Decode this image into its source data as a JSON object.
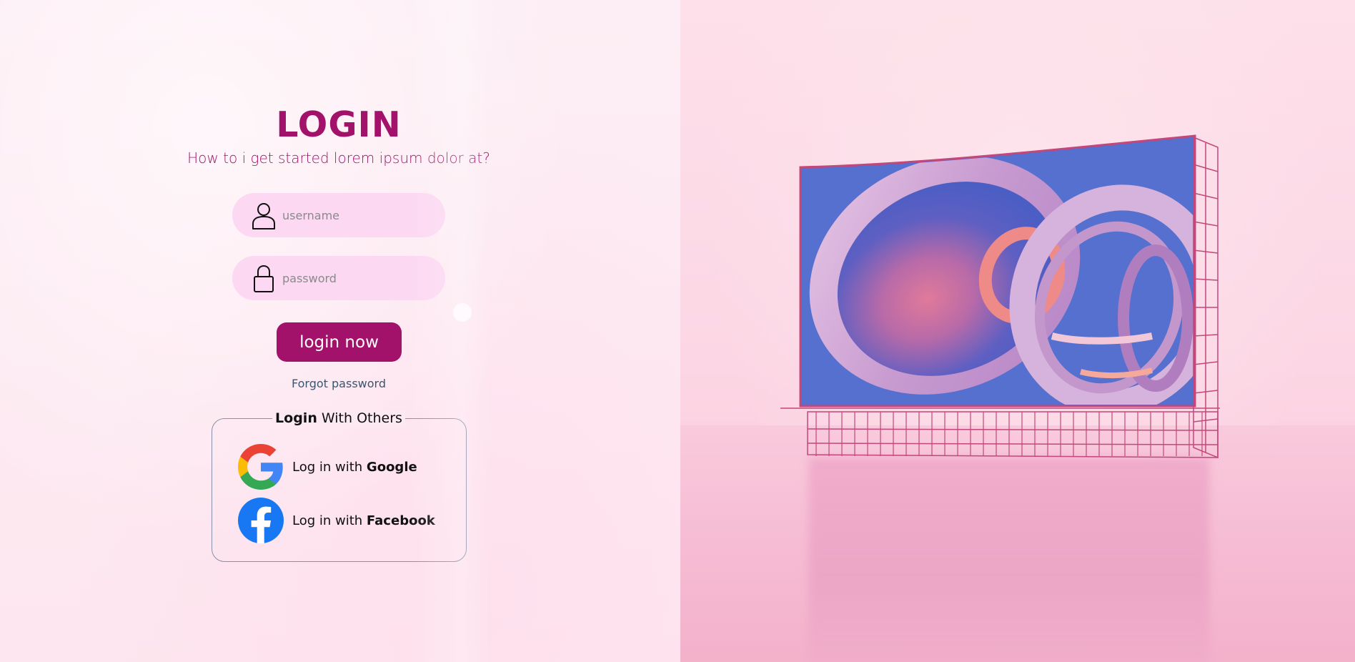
{
  "login": {
    "title": "LOGIN",
    "subtitle": "How to i get started lorem ipsum dolor at?",
    "username_placeholder": "username",
    "password_placeholder": "password",
    "submit_label": "login now",
    "forgot_label": "Forgot password"
  },
  "others": {
    "legend_bold": "Login",
    "legend_rest": " With Others",
    "google_prefix": "Log in with ",
    "google_name": "Google",
    "facebook_prefix": "Log in with ",
    "facebook_name": "Facebook"
  },
  "icons": {
    "username": "user-icon",
    "password": "lock-icon",
    "google": "google-logo-icon",
    "facebook": "facebook-logo-icon"
  },
  "colors": {
    "accent": "#a3126a",
    "field_bg": "#fcd8f2",
    "page_bg": "#fde8f1",
    "facebook_blue": "#1877f2"
  }
}
